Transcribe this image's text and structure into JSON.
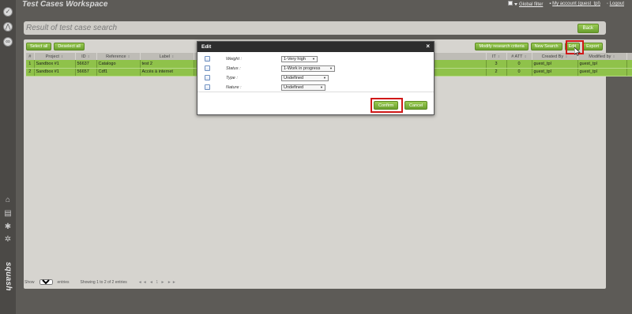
{
  "app": {
    "workspace_title": "Test Cases Workspace",
    "brand": "squash"
  },
  "topbar": {
    "global_filter": "Global filter",
    "my_account": "My account (guest_tpl)",
    "logout": "Logout"
  },
  "header": {
    "title": "Result of test case search",
    "back_label": "Back"
  },
  "toolbar": {
    "select_all": "Select all",
    "deselect_all": "Deselect all",
    "modify_criteria": "Modify research criteria",
    "new_search": "New Search",
    "edit": "Edit",
    "export": "Export"
  },
  "table": {
    "columns": [
      "#",
      "Project",
      "ID",
      "Reference",
      "Label",
      "",
      "IT",
      "# ATT",
      "Created By",
      "Modified by",
      "",
      ""
    ],
    "rows": [
      {
        "num": "1",
        "project": "Sandbox #1",
        "id": "56637",
        "reference": "Catalogo",
        "label": "test 2",
        "it": "3",
        "att": "0",
        "created_by": "guest_tpl",
        "modified_by": "guest_tpl"
      },
      {
        "num": "2",
        "project": "Sandbox #1",
        "id": "56657",
        "reference": "Cdf1",
        "label": "Accès à internet",
        "it": "2",
        "att": "0",
        "created_by": "guest_tpl",
        "modified_by": "guest_tpl"
      }
    ]
  },
  "footer": {
    "show": "Show",
    "page_size": "50",
    "entries": "entries",
    "showing": "Showing 1 to 2 of 2 entries",
    "pager": "◄◄ ◄ 1 ► ►►"
  },
  "modal": {
    "title": "Edit",
    "close": "×",
    "fields": [
      {
        "label": "Weight :",
        "value": "1-Very high"
      },
      {
        "label": "Status :",
        "value": "1-Work in progress"
      },
      {
        "label": "Type :",
        "value": "Undefined"
      },
      {
        "label": "Nature :",
        "value": "Undefined"
      }
    ],
    "confirm": "Confirm",
    "cancel": "Cancel"
  },
  "colors": {
    "accent_green": "#8fc24a",
    "highlight_red": "#d01818",
    "modal_header": "#2d2d2d"
  }
}
